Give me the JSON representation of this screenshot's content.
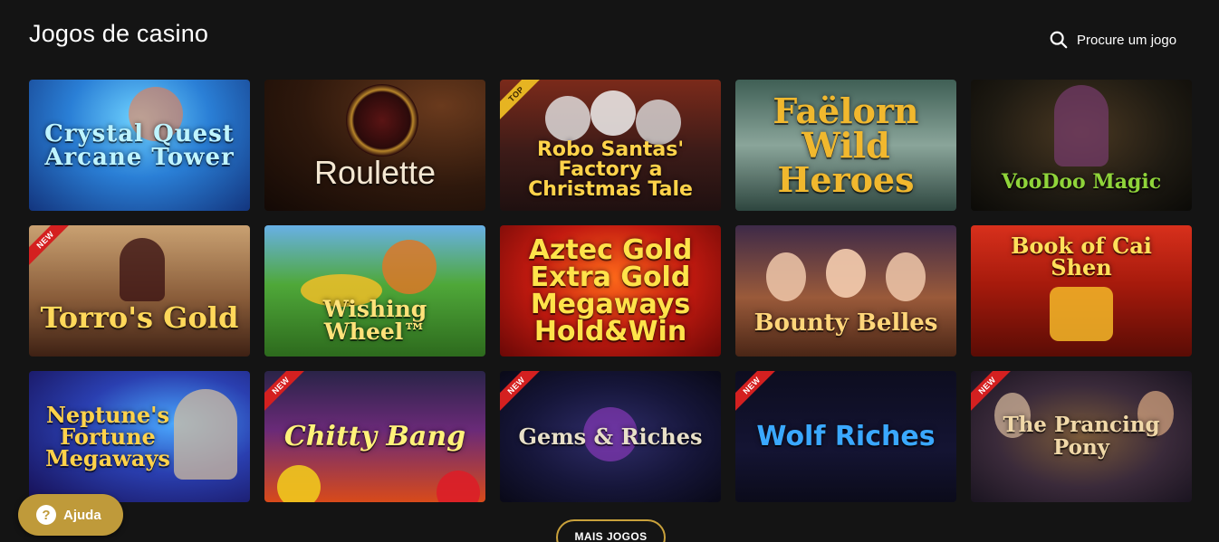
{
  "header": {
    "title": "Jogos de casino",
    "search_label": "Procure um jogo"
  },
  "games": [
    {
      "name": "Crystal Quest Arcane Tower",
      "badge": ""
    },
    {
      "name": "Roulette",
      "badge": ""
    },
    {
      "name": "Robo Santas' Factory a Christmas Tale",
      "badge": "TOP"
    },
    {
      "name": "Faëlorn Wild Heroes",
      "badge": ""
    },
    {
      "name": "VooDoo Magic",
      "badge": ""
    },
    {
      "name": "Torro's Gold",
      "badge": "NEW"
    },
    {
      "name": "Wishing Wheel™",
      "badge": ""
    },
    {
      "name": "Aztec Gold Extra Gold Megaways Hold&Win",
      "badge": ""
    },
    {
      "name": "Bounty Belles",
      "badge": ""
    },
    {
      "name": "Book of Cai Shen",
      "badge": ""
    },
    {
      "name": "Neptune's Fortune Megaways",
      "badge": ""
    },
    {
      "name": "Chitty Bang",
      "badge": "NEW"
    },
    {
      "name": "Gems & Riches",
      "badge": "NEW"
    },
    {
      "name": "Wolf Riches",
      "badge": "NEW"
    },
    {
      "name": "The Prancing Pony",
      "badge": "NEW"
    }
  ],
  "footer": {
    "more_label": "MAIS JOGOS",
    "help_label": "Ajuda",
    "help_icon": "?"
  },
  "colors": {
    "background": "#141414",
    "accent_gold": "#c9a13b",
    "help_button": "#bf9a3a",
    "badge_new": "#d42020",
    "badge_top": "#e6b422"
  }
}
